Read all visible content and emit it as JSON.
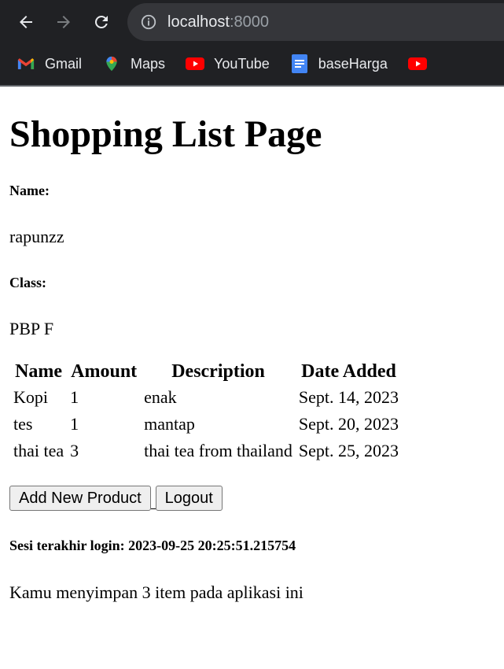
{
  "browser": {
    "url_host": "localhost",
    "url_port": ":8000",
    "bookmarks": [
      {
        "label": "Gmail",
        "icon": "gmail-icon"
      },
      {
        "label": "Maps",
        "icon": "maps-icon"
      },
      {
        "label": "YouTube",
        "icon": "youtube-icon"
      },
      {
        "label": "baseHarga",
        "icon": "docs-icon"
      },
      {
        "label": "",
        "icon": "youtube-icon"
      }
    ],
    "colors": {
      "chrome_bg": "#202124",
      "omnibox_bg": "#35363a",
      "text": "#e8eaed"
    }
  },
  "page": {
    "title": "Shopping List Page",
    "name_label": "Name:",
    "name_value": "rapunzz",
    "class_label": "Class:",
    "class_value": "PBP F",
    "table": {
      "headers": [
        "Name",
        "Amount",
        "Description",
        "Date Added"
      ],
      "rows": [
        [
          "Kopi",
          "1",
          "enak",
          "Sept. 14, 2023"
        ],
        [
          "tes",
          "1",
          "mantap",
          "Sept. 20, 2023"
        ],
        [
          "thai tea",
          "3",
          "thai tea from thailand",
          "Sept. 25, 2023"
        ]
      ]
    },
    "add_button": "Add New Product",
    "logout_button": "Logout",
    "last_login": "Sesi terakhir login: 2023-09-25 20:25:51.215754",
    "summary": "Kamu menyimpan 3 item pada aplikasi ini"
  }
}
